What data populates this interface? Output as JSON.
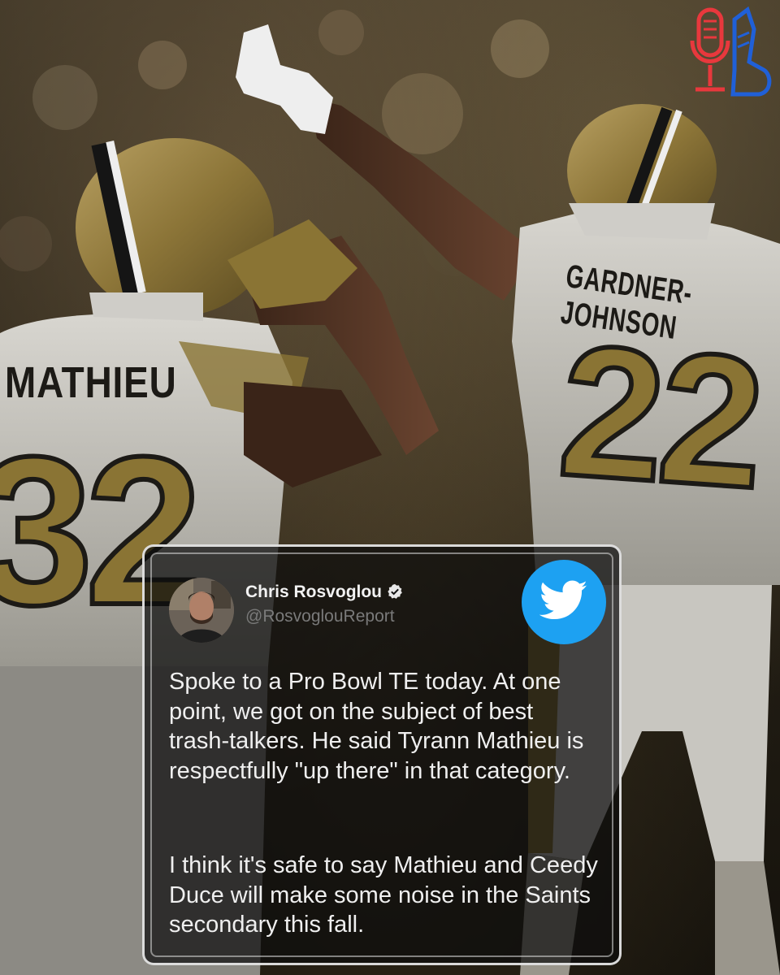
{
  "image": {
    "left_player": {
      "name": "MATHIEU",
      "number": "32"
    },
    "right_player": {
      "name": "GARDNER-JOHNSON",
      "number": "22"
    }
  },
  "colors": {
    "saints_gold": "#8a7434",
    "twitter_blue": "#1da1f2",
    "logo_red": "#e8383d",
    "logo_blue": "#2060d8"
  },
  "tweet": {
    "author_name": "Chris Rosvoglou",
    "handle": "@RosvoglouReport",
    "verified_icon": "verified-badge-icon",
    "platform_icon": "twitter-bird-icon",
    "paragraphs": [
      "Spoke to a Pro Bowl TE today. At one point, we got on the subject of best trash-talkers. He said Tyrann Mathieu is respectfully \"up there\" in that category.",
      "I think it's safe to say Mathieu and Ceedy Duce will make some noise in the Saints secondary this fall."
    ]
  },
  "logo": {
    "icon": "microphone-boot-logo-icon"
  }
}
